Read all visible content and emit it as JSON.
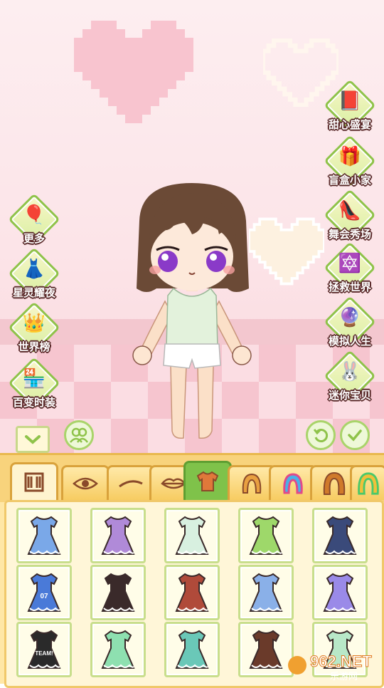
{
  "side_menu_left": [
    {
      "label": "更多",
      "icon": "balloons-icon"
    },
    {
      "label": "星灵耀夜",
      "icon": "starry-dress-icon"
    },
    {
      "label": "世界榜",
      "icon": "crown-icon"
    },
    {
      "label": "百变时装",
      "icon": "shop-icon"
    }
  ],
  "side_menu_right": [
    {
      "label": "甜心盛宴",
      "icon": "card-icon"
    },
    {
      "label": "盲盒小家",
      "icon": "blind-box-icon"
    },
    {
      "label": "舞会秀场",
      "icon": "high-heel-icon"
    },
    {
      "label": "拯救世界",
      "icon": "magic-circle-icon"
    },
    {
      "label": "模拟人生",
      "icon": "crystal-ball-icon"
    },
    {
      "label": "迷你宝贝",
      "icon": "bunny-cake-icon"
    }
  ],
  "tabs": [
    {
      "name": "tab-face",
      "icon": "face-shape-icon"
    },
    {
      "name": "tab-eyes",
      "icon": "eye-icon"
    },
    {
      "name": "tab-eyebrows",
      "icon": "eyebrow-icon"
    },
    {
      "name": "tab-mouth",
      "icon": "lips-icon"
    },
    {
      "name": "tab-clothes",
      "icon": "shirt-icon",
      "active": true
    },
    {
      "name": "tab-hair-front",
      "icon": "hair-icon"
    },
    {
      "name": "tab-hair-color",
      "icon": "rainbow-hair-icon"
    },
    {
      "name": "tab-hair-back",
      "icon": "long-hair-icon"
    },
    {
      "name": "tab-hair-color-2",
      "icon": "rainbow-hair-2-icon"
    }
  ],
  "outfits": [
    {
      "name": "blue-lace-dress",
      "color": "#7aa8e8"
    },
    {
      "name": "purple-tutu-dress",
      "color": "#b08ad8"
    },
    {
      "name": "white-green-robe",
      "color": "#d8f0e0"
    },
    {
      "name": "green-pink-dress",
      "color": "#9ed86a"
    },
    {
      "name": "navy-stripe-outfit",
      "color": "#3a4a7a"
    },
    {
      "name": "blue-sports-jersey",
      "color": "#4a7ad8",
      "text": "07"
    },
    {
      "name": "maid-dress",
      "color": "#3a2a2a"
    },
    {
      "name": "red-lavender-outfit",
      "color": "#b04a3a"
    },
    {
      "name": "blue-kimono",
      "color": "#8ab0e8"
    },
    {
      "name": "lilac-polka-dress",
      "color": "#9a8ae8"
    },
    {
      "name": "team-tshirt-skirt",
      "color": "#2a2a2a",
      "text": "TEAM!"
    },
    {
      "name": "mint-bear-dress",
      "color": "#8ee0b0"
    },
    {
      "name": "teal-chinese-dress",
      "color": "#6ac8b8"
    },
    {
      "name": "brown-coat-outfit",
      "color": "#6a3a2a"
    },
    {
      "name": "mint-white-dress",
      "color": "#b8e8c8"
    }
  ],
  "colors": {
    "accent_green": "#8fc34a",
    "panel_yellow": "#ffe7a6",
    "tab_gold": "#f7cc62"
  },
  "watermark": {
    "brand_top": "962.NET",
    "brand_bottom": "乐游网"
  }
}
